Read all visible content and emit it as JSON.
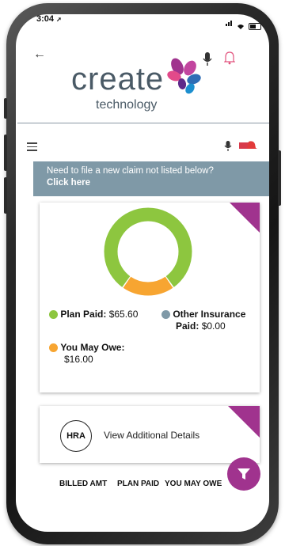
{
  "status_bar": {
    "time": "3:04"
  },
  "header": {
    "logo_word": "create",
    "logo_sub": "technology"
  },
  "banner": {
    "line1": "Need to file a new claim not listed below?",
    "line2": "Click here"
  },
  "chart_data": {
    "type": "pie",
    "slices": [
      {
        "label": "Plan Paid",
        "value": 65.6,
        "color": "#8dc63f"
      },
      {
        "label": "Other Insurance Paid",
        "value": 0.0,
        "color": "#7f99a7"
      },
      {
        "label": "You May Owe",
        "value": 16.0,
        "color": "#f7a531"
      }
    ]
  },
  "legend": {
    "plan_paid_label": "Plan Paid:",
    "plan_paid_value": "$65.60",
    "other_label_1": "Other Insurance",
    "other_label_2": "Paid:",
    "other_value": "$0.00",
    "owe_label": "You May Owe:",
    "owe_value": "$16.00"
  },
  "details_card": {
    "badge": "HRA",
    "link": "View Additional Details"
  },
  "columns": [
    "BILLED AMT",
    "PLAN PAID",
    "YOU MAY OWE"
  ],
  "colors": {
    "accent": "#a0338e",
    "banner": "#7f99a7",
    "plan": "#8dc63f",
    "owe": "#f7a531"
  },
  "icons": [
    "back-arrow-icon",
    "mic-icon",
    "bell-icon",
    "menu-icon",
    "filter-icon"
  ]
}
